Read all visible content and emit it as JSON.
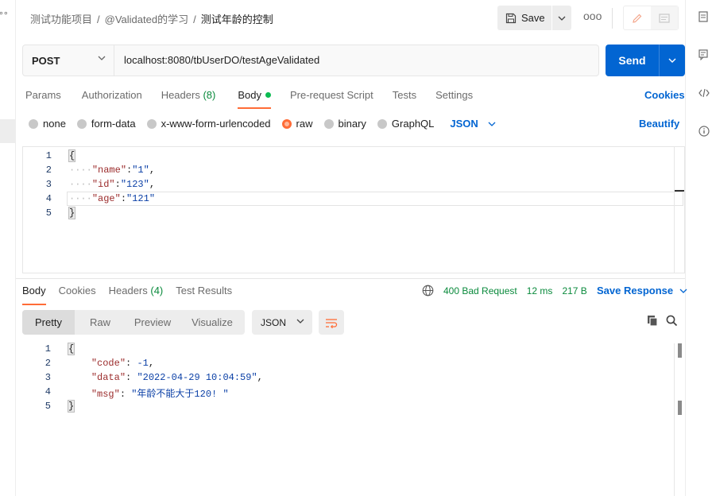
{
  "sidebar": {
    "dots_icon": "more-dots-icon"
  },
  "header": {
    "breadcrumbs": [
      "测试功能项目",
      "@Validated的学习",
      "测试年龄的控制"
    ],
    "save_label": "Save",
    "more_label": "ooo"
  },
  "request": {
    "method": "POST",
    "url": "localhost:8080/tbUserDO/testAgeValidated",
    "send_label": "Send",
    "tabs": [
      {
        "label": "Params"
      },
      {
        "label": "Authorization"
      },
      {
        "label": "Headers",
        "count": "(8)"
      },
      {
        "label": "Body"
      },
      {
        "label": "Pre-request Script"
      },
      {
        "label": "Tests"
      },
      {
        "label": "Settings"
      }
    ],
    "cookies_label": "Cookies",
    "body_types": [
      "none",
      "form-data",
      "x-www-form-urlencoded",
      "raw",
      "binary",
      "GraphQL"
    ],
    "body_type_selected": "raw",
    "format": "JSON",
    "beautify_label": "Beautify",
    "line_numbers": [
      "1",
      "2",
      "3",
      "4",
      "5"
    ],
    "body_lines": {
      "open": "{",
      "name_key": "\"name\"",
      "name_val": "\"1\"",
      "id_key": "\"id\"",
      "id_val": "\"123\"",
      "age_key": "\"age\"",
      "age_val": "\"121\"",
      "close": "}"
    }
  },
  "response": {
    "tabs": [
      {
        "label": "Body"
      },
      {
        "label": "Cookies"
      },
      {
        "label": "Headers",
        "count": "(4)"
      },
      {
        "label": "Test Results"
      }
    ],
    "status": "400 Bad Request",
    "time": "12 ms",
    "size": "217 B",
    "save_response_label": "Save Response",
    "view_modes": [
      "Pretty",
      "Raw",
      "Preview",
      "Visualize"
    ],
    "format": "JSON",
    "line_numbers": [
      "1",
      "2",
      "3",
      "4",
      "5"
    ],
    "body_lines": {
      "open": "{",
      "code_key": "\"code\"",
      "code_val": "-1",
      "data_key": "\"data\"",
      "data_val": "\"2022-04-29 10:04:59\"",
      "msg_key": "\"msg\"",
      "msg_val": "\"年龄不能大于120! \"",
      "close": "}"
    }
  },
  "colors": {
    "accent": "#ff6c37",
    "primary": "#0265d2",
    "status_ok": "#0a8a3c"
  }
}
